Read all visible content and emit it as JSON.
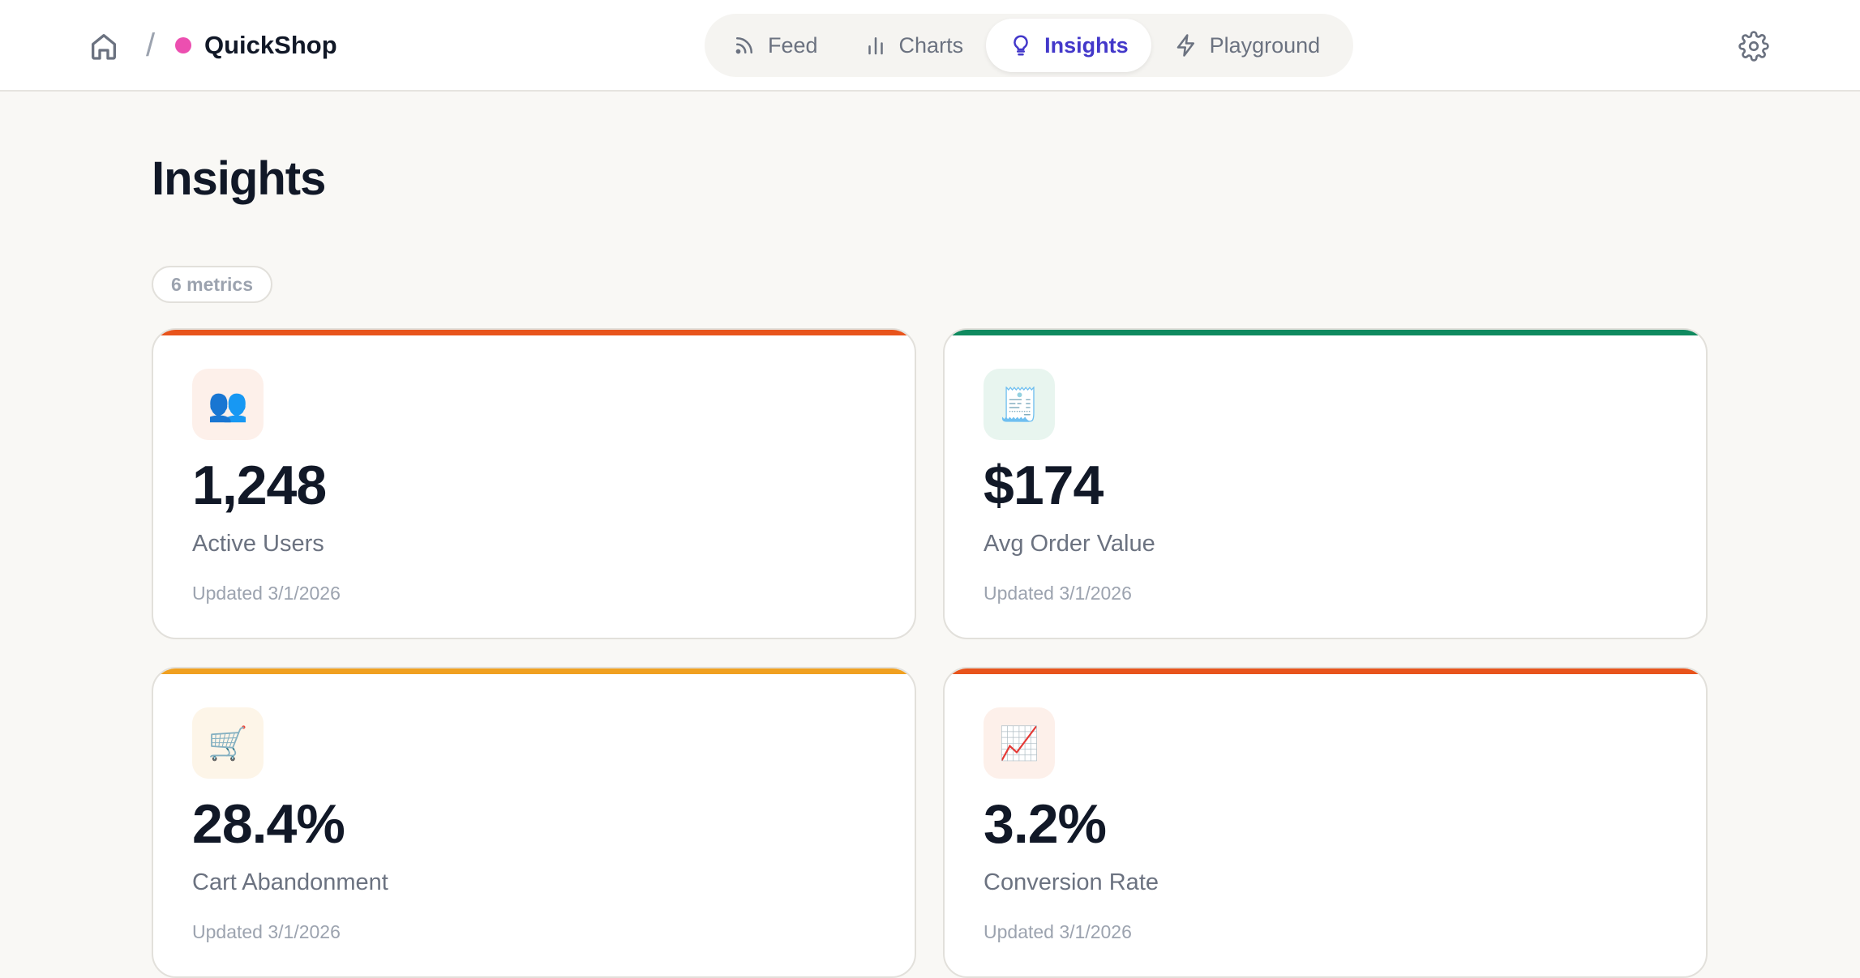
{
  "header": {
    "brand_name": "QuickShop",
    "brand_color": "#ec4fb0",
    "crumb_separator": "/",
    "home_icon": "home-icon",
    "settings_icon": "gear-icon",
    "tabs": [
      {
        "label": "Feed",
        "icon": "rss-icon",
        "active": false
      },
      {
        "label": "Charts",
        "icon": "bar-chart-icon",
        "active": false
      },
      {
        "label": "Insights",
        "icon": "lightbulb-icon",
        "active": true
      },
      {
        "label": "Playground",
        "icon": "bolt-icon",
        "active": false
      }
    ]
  },
  "main": {
    "title": "Insights",
    "count_badge": "6 metrics",
    "cards": [
      {
        "icon": "👥",
        "icon_name": "users-icon",
        "value": "1,248",
        "label": "Active Users",
        "updated": "Updated 3/1/2026",
        "accent": "#e8541c",
        "tint": "#fdf0ea"
      },
      {
        "icon": "🧾",
        "icon_name": "receipt-icon",
        "value": "$174",
        "label": "Avg Order Value",
        "updated": "Updated 3/1/2026",
        "accent": "#0f8a5f",
        "tint": "#e8f5ef"
      },
      {
        "icon": "🛒",
        "icon_name": "cart-icon",
        "value": "28.4%",
        "label": "Cart Abandonment",
        "updated": "Updated 3/1/2026",
        "accent": "#f0a020",
        "tint": "#fdf5e8"
      },
      {
        "icon": "📈",
        "icon_name": "trend-up-icon",
        "value": "3.2%",
        "label": "Conversion Rate",
        "updated": "Updated 3/1/2026",
        "accent": "#e8541c",
        "tint": "#fdf0ea"
      }
    ]
  }
}
